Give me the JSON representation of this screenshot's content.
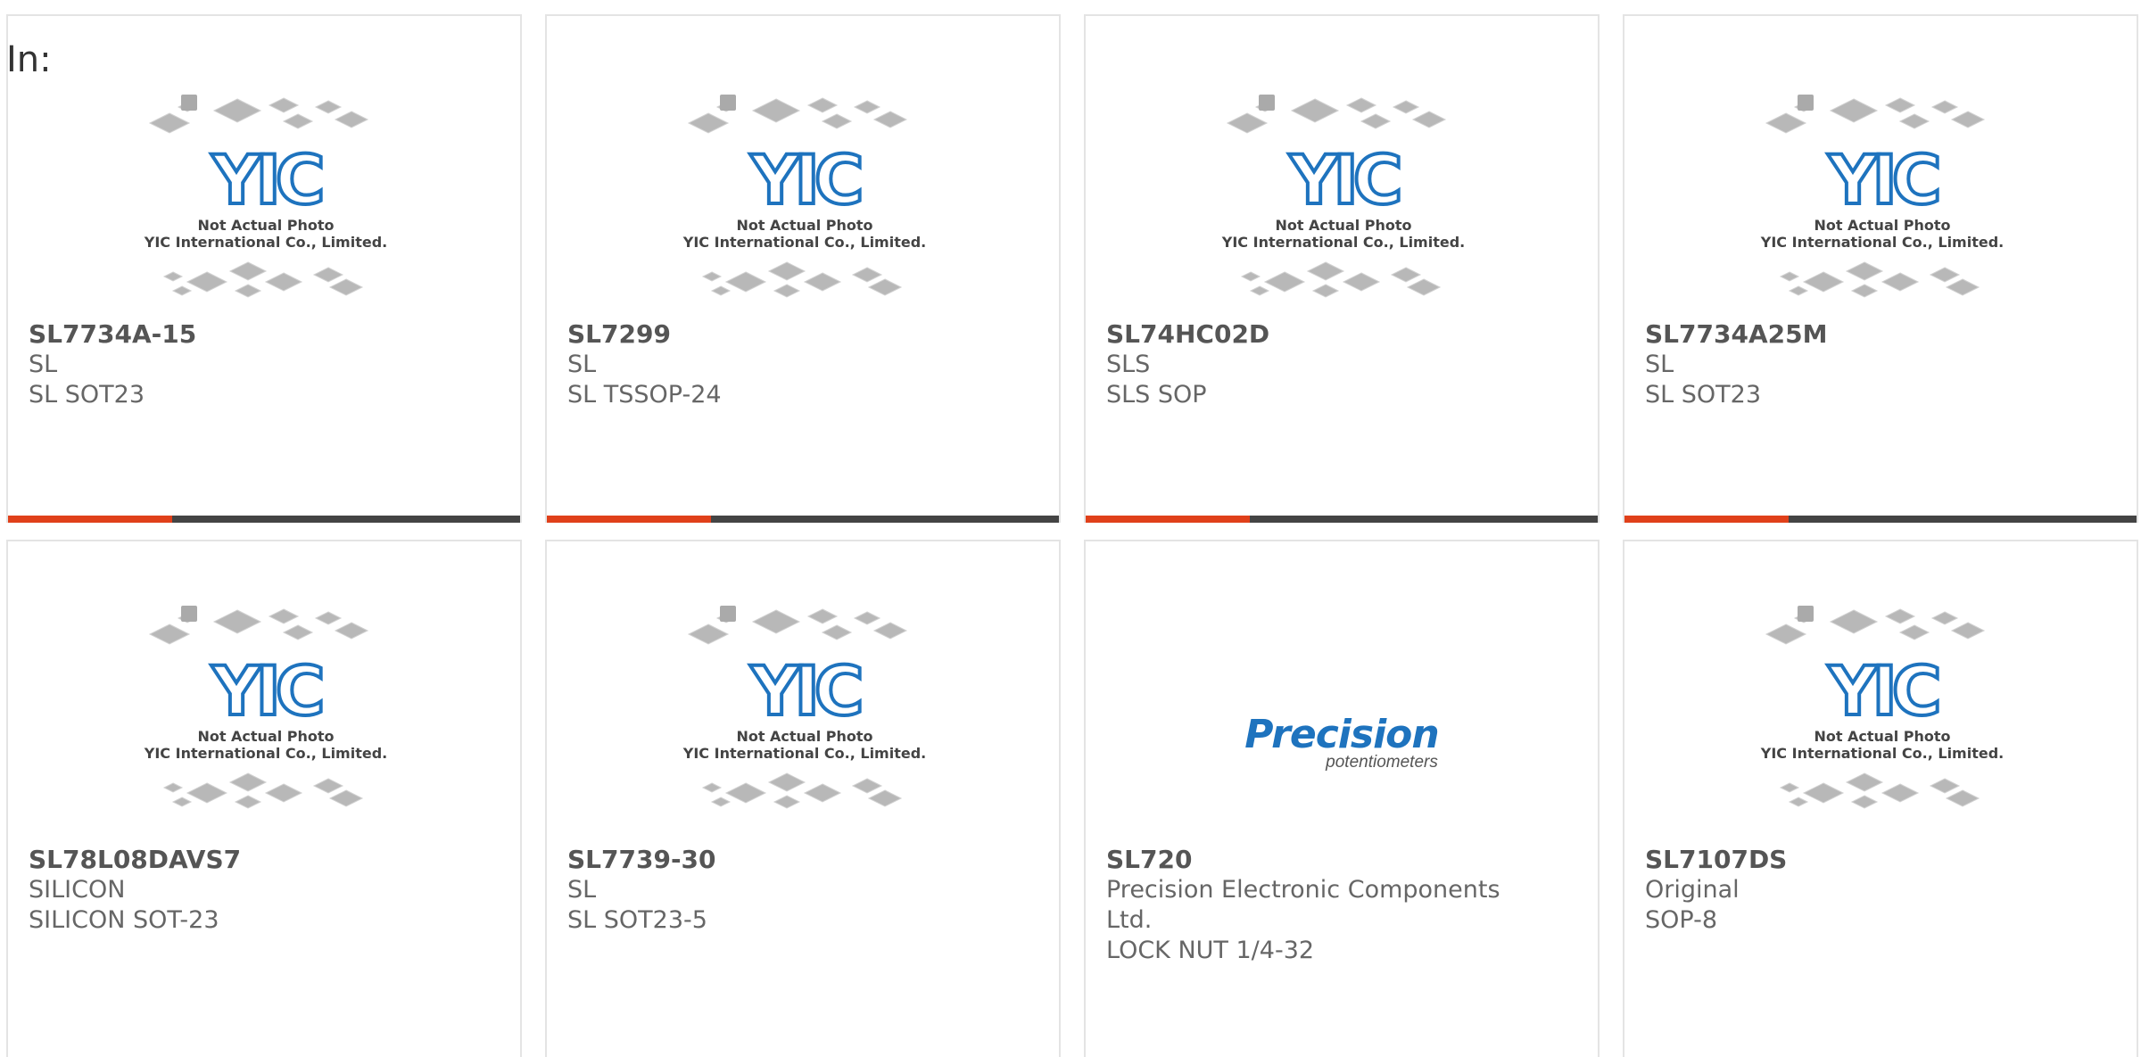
{
  "heading": "In:",
  "colors": {
    "accent": "#e0401a",
    "bar": "#444444",
    "brand_blue": "#1e73be",
    "chip_gray": "#b8b8b8"
  },
  "placeholder": {
    "caption1": "Not Actual Photo",
    "caption2": "YIC International Co., Limited.",
    "logo": "YIC"
  },
  "precision_logo": {
    "word": "Precision",
    "sub": "potentiometers"
  },
  "products": [
    {
      "part": "SL7734A-15",
      "lines": [
        "SL",
        "SL SOT23"
      ],
      "image": "yic"
    },
    {
      "part": "SL7299",
      "lines": [
        "SL",
        "SL TSSOP-24"
      ],
      "image": "yic"
    },
    {
      "part": "SL74HC02D",
      "lines": [
        "SLS",
        "SLS SOP"
      ],
      "image": "yic"
    },
    {
      "part": "SL7734A25M",
      "lines": [
        "SL",
        "SL SOT23"
      ],
      "image": "yic"
    },
    {
      "part": "SL78L08DAVS7",
      "lines": [
        "SILICON",
        "SILICON SOT-23"
      ],
      "image": "yic"
    },
    {
      "part": "SL7739-30",
      "lines": [
        "SL",
        "SL SOT23-5"
      ],
      "image": "yic"
    },
    {
      "part": "SL720",
      "lines": [
        "Precision Electronic Components",
        "Ltd.",
        "LOCK NUT 1/4-32"
      ],
      "image": "precision"
    },
    {
      "part": "SL7107DS",
      "lines": [
        "Original",
        "SOP-8"
      ],
      "image": "yic"
    }
  ]
}
